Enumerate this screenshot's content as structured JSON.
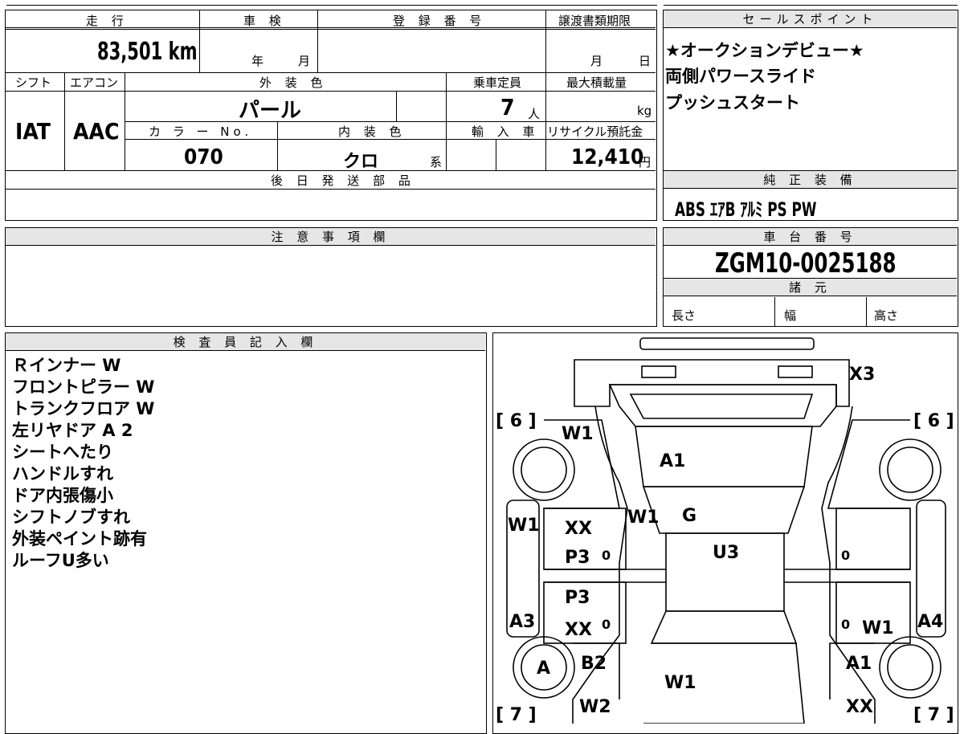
{
  "spec": {
    "headers": {
      "mileage": "走 行",
      "inspection": "車 検",
      "registration": "登 録 番 号",
      "transfer": "譲渡書類期限",
      "shift": "シフト",
      "aircon": "エアコン",
      "exterior": "外 装 色",
      "capacity": "乗車定員",
      "max_load": "最大積載量",
      "color_no": "カ ラ ー No.",
      "interior": "内 装 色",
      "import": "輸 入 車",
      "recycle": "リサイクル預託金",
      "parts": "後 日 発 送 部 品"
    },
    "mileage_value": "83,501",
    "mileage_unit": "km",
    "inspection_year": "年",
    "inspection_month": "月",
    "transfer_month": "月",
    "transfer_day": "日",
    "shift_value": "IAT",
    "aircon_value": "AAC",
    "exterior_value": "パール",
    "capacity_value": "7",
    "capacity_unit": "人",
    "max_load_unit": "kg",
    "color_no_value": "070",
    "interior_value": "クロ",
    "interior_suffix": "系",
    "recycle_value": "12,410",
    "recycle_unit": "円"
  },
  "sales": {
    "title": "セールスポイント",
    "lines": [
      "★オークションデビュー★",
      "両側パワースライド",
      "プッシュスタート"
    ]
  },
  "equipment": {
    "title": "純 正 装 備",
    "items": "ABS ｴｱB ｱﾙﾐ PS PW"
  },
  "notes": {
    "title": "注 意 事 項 欄"
  },
  "chassis": {
    "title": "車 台 番 号",
    "value": "ZGM10-0025188",
    "dims_title": "諸 元",
    "length": "長さ",
    "width": "幅",
    "height": "高さ"
  },
  "inspector": {
    "title": "検 査 員 記 入 欄",
    "lines": [
      "Ｒインナー W",
      "フロントピラー W",
      "トランクフロア W",
      "左リヤドア A 2",
      "シートへたり",
      "ハンドルすれ",
      "ドア内張傷小",
      "シフトノブすれ",
      "外装ペイント跡有",
      "ルーフU多い"
    ]
  },
  "diagram": {
    "tire_front_left": "[ 6 ]",
    "tire_front_right": "[ 6 ]",
    "tire_rear_left": "[ 7 ]",
    "tire_rear_right": "[ 7 ]",
    "marks": {
      "rear_bumper": "X3",
      "rear_left_quarter": "W1",
      "rear_glass": "A1",
      "left_pillar": "W1",
      "rear_roof": "G",
      "roof": "U3",
      "left_rocker_rear": "W1",
      "rear_door_left_1": "XX",
      "rear_door_left_2": "P3",
      "front_door_left_1": "P3",
      "front_door_left_2": "XX",
      "left_rocker_front": "A3",
      "right_rocker_front": "A4",
      "right_front_door": "W1",
      "front_wheel_left": "A",
      "front_fender_left": "B2",
      "hood": "W1",
      "front_fender_right": "A1",
      "front_bumper_left": "W2",
      "front_bumper_right": "XX",
      "zero_1": "0",
      "zero_2": "0",
      "zero_3": "0",
      "zero_4": "0"
    }
  }
}
